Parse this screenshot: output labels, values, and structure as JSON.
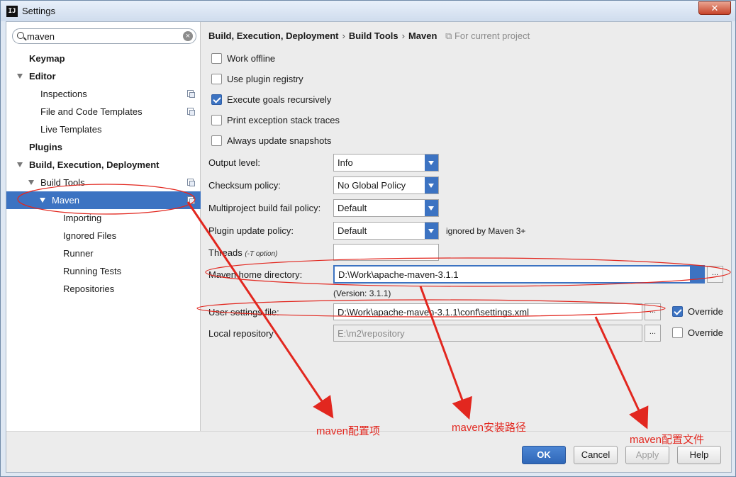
{
  "window": {
    "title": "Settings",
    "app_icon": "IJ",
    "close_glyph": "✕"
  },
  "sidebar": {
    "search": {
      "value": "maven"
    },
    "items": [
      {
        "label": "Keymap"
      },
      {
        "label": "Editor"
      },
      {
        "label": "Inspections"
      },
      {
        "label": "File and Code Templates"
      },
      {
        "label": "Live Templates"
      },
      {
        "label": "Plugins"
      },
      {
        "label": "Build, Execution, Deployment"
      },
      {
        "label": "Build Tools"
      },
      {
        "label": "Maven"
      },
      {
        "label": "Importing"
      },
      {
        "label": "Ignored Files"
      },
      {
        "label": "Runner"
      },
      {
        "label": "Running Tests"
      },
      {
        "label": "Repositories"
      }
    ]
  },
  "breadcrumb": {
    "parts": [
      "Build, Execution, Deployment",
      "Build Tools",
      "Maven"
    ],
    "separator": "›",
    "scope": "For current project"
  },
  "options": {
    "work_offline": {
      "label": "Work offline",
      "checked": false
    },
    "use_plugin_registry": {
      "label": "Use plugin registry",
      "checked": false
    },
    "execute_goals": {
      "label": "Execute goals recursively",
      "checked": true
    },
    "print_exception": {
      "label": "Print exception stack traces",
      "checked": false
    },
    "always_update": {
      "label": "Always update snapshots",
      "checked": false
    }
  },
  "fields": {
    "output_level": {
      "label": "Output level:",
      "value": "Info"
    },
    "checksum_policy": {
      "label": "Checksum policy:",
      "value": "No Global Policy"
    },
    "multiproject": {
      "label": "Multiproject build fail policy:",
      "value": "Default"
    },
    "plugin_update": {
      "label": "Plugin update policy:",
      "value": "Default",
      "note": "ignored by Maven 3+"
    },
    "threads": {
      "label": "Threads",
      "hint": "(-T option)",
      "value": ""
    },
    "maven_home": {
      "label": "Maven home directory:",
      "value": "D:\\Work\\apache-maven-3.1.1",
      "version": "(Version: 3.1.1)"
    },
    "user_settings": {
      "label": "User settings file:",
      "value": "D:\\Work\\apache-maven-3.1.1\\conf\\settings.xml",
      "override_label": "Override",
      "override": true
    },
    "local_repo": {
      "label": "Local repository",
      "value": "E:\\m2\\repository",
      "override_label": "Override",
      "override": false
    },
    "browse_glyph": "..."
  },
  "buttons": {
    "ok": "OK",
    "cancel": "Cancel",
    "apply": "Apply",
    "help": "Help"
  },
  "annotations": {
    "color": "#e2271f",
    "config_item": "maven配置项",
    "install_path": "maven安装路径",
    "config_file": "maven配置文件"
  }
}
